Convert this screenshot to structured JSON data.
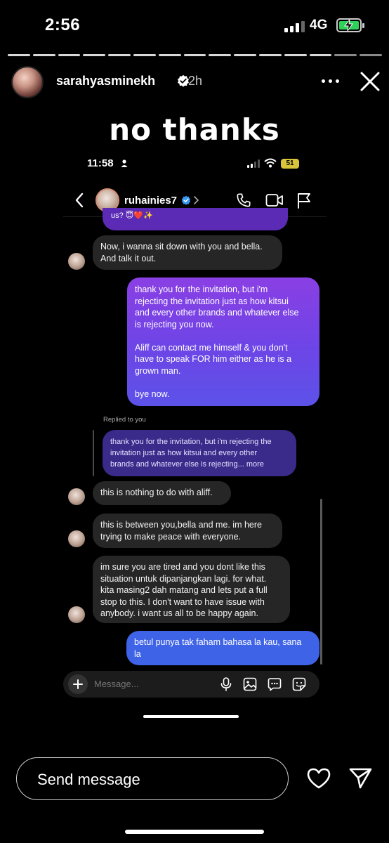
{
  "status_bar": {
    "time": "2:56",
    "network": "4G"
  },
  "story": {
    "username": "sarahyasminekh",
    "time_ago": "2h",
    "caption": "no thanks",
    "reply_placeholder": "Send message",
    "progress_total": 15,
    "progress_done": 13
  },
  "embedded": {
    "status_time": "11:58",
    "battery": "51",
    "chat_username": "ruhainies7",
    "composer_placeholder": "Message...",
    "reply_label": "Replied to you",
    "messages": [
      {
        "from": "them",
        "text": "us? 😇❤️✨"
      },
      {
        "from": "them",
        "text": "Now, i wanna sit down with you and bella.\nAnd talk it out."
      },
      {
        "from": "me",
        "text": "thank you for the invitation, but i'm\nrejecting the invitation just as how kitsui\nand every other brands and whatever else\nis rejecting you now.\n\nAliff can contact me himself & you don't\nhave to speak FOR him either as he is a\ngrown man.\n\nbye now."
      },
      {
        "from": "quote",
        "text": "thank you for the invitation, but i'm rejecting the\ninvitation just as how kitsui and every other\nbrands and whatever else is rejecting... more"
      },
      {
        "from": "them",
        "text": "this is nothing to do with aliff."
      },
      {
        "from": "them",
        "text": "this is between you,bella and me. im here\ntrying to make peace with everyone."
      },
      {
        "from": "them",
        "text": "im sure you are tired and you dont like this\nsituation untuk dipanjangkan lagi. for what.\nkita masing2 dah matang and lets put a full\nstop to this. I don't want to have issue with\nanybody. i want us all to be happy again."
      },
      {
        "from": "me",
        "text": "betul punya tak faham bahasa la kau, sana\nla"
      }
    ]
  }
}
